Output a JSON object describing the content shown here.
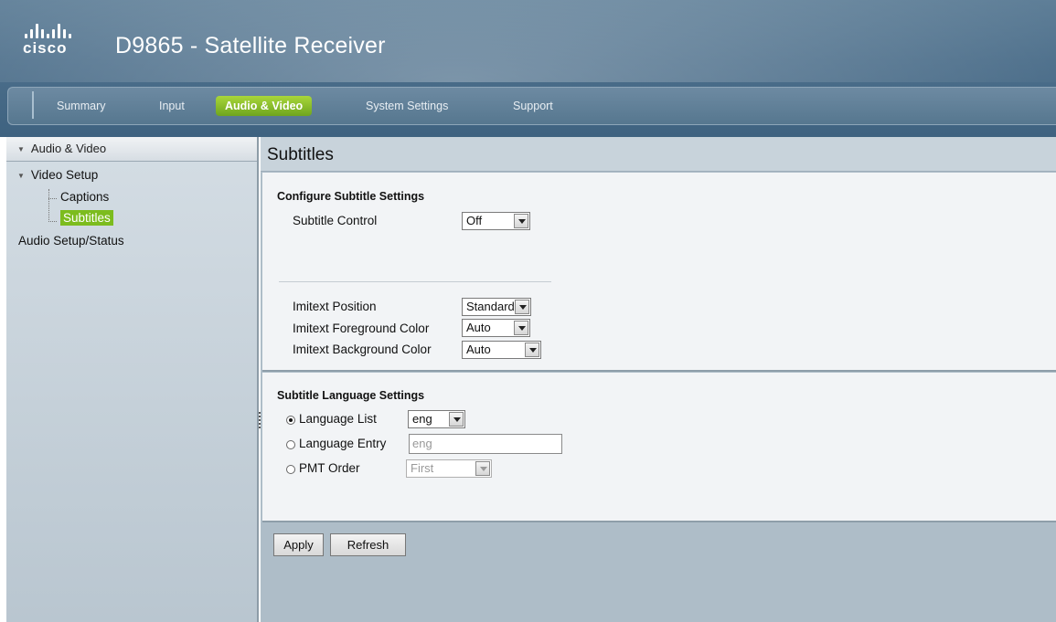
{
  "header": {
    "brand": "cisco",
    "title": "D9865 - Satellite Receiver"
  },
  "nav": {
    "tabs": [
      {
        "label": "Summary"
      },
      {
        "label": "Input"
      },
      {
        "label": "Audio & Video"
      },
      {
        "label": "System Settings"
      },
      {
        "label": "Support"
      }
    ],
    "active_tab": "Audio & Video"
  },
  "sidebar": {
    "header": "Audio & Video",
    "items": [
      {
        "label": "Video Setup"
      },
      {
        "label": "Captions"
      },
      {
        "label": "Subtitles"
      },
      {
        "label": "Audio Setup/Status"
      }
    ]
  },
  "main": {
    "title": "Subtitles",
    "configure": {
      "heading": "Configure Subtitle Settings",
      "subtitle_control": {
        "label": "Subtitle Control",
        "value": "Off"
      },
      "imitext_position": {
        "label": "Imitext Position",
        "value": "Standard"
      },
      "imitext_foreground": {
        "label": "Imitext Foreground Color",
        "value": "Auto"
      },
      "imitext_background": {
        "label": "Imitext Background Color",
        "value": "Auto"
      }
    },
    "language": {
      "heading": "Subtitle Language Settings",
      "language_list": {
        "label": "Language List",
        "value": "eng",
        "selected": true
      },
      "language_entry": {
        "label": "Language Entry",
        "value": "eng"
      },
      "pmt_order": {
        "label": "PMT Order",
        "value": "First"
      }
    },
    "buttons": {
      "apply": "Apply",
      "refresh": "Refresh"
    }
  },
  "colors": {
    "accent_green": "#7cbc1e",
    "header_blue": "#4d6f8b"
  },
  "icons": [
    "cisco-logo-icon",
    "triangle-down-icon",
    "dropdown-arrow-icon",
    "radio-icon"
  ]
}
